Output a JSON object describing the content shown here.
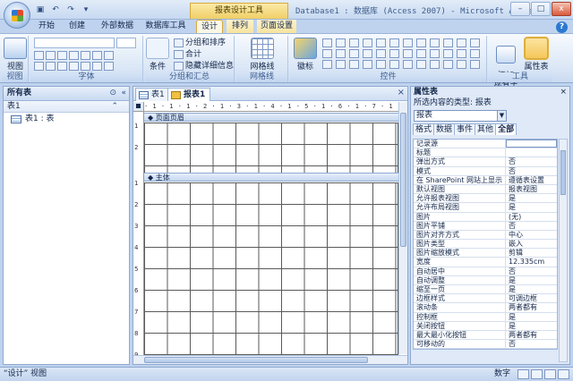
{
  "window": {
    "title": "Database1 : 数据库 (Access 2007) - Microsoft Access",
    "context_tab_title": "报表设计工具",
    "controls": [
      "–",
      "□",
      "x"
    ]
  },
  "ribbon_tabs": [
    "开始",
    "创建",
    "外部数据",
    "数据库工具",
    "设计",
    "排列",
    "页面设置"
  ],
  "active_tab": "设计",
  "ribbon": {
    "views_group": {
      "button": "视图",
      "label": "视图"
    },
    "font_group": {
      "label": "字体"
    },
    "grouping_group": {
      "group_sort": "分组和排序",
      "totals": "合计",
      "hide_details": "隐藏详细信息",
      "condition": "条件",
      "label": "分组和汇总"
    },
    "gridlines_group": {
      "button": "网格线",
      "label": "网格线"
    },
    "controls_group": {
      "logo": "徽标",
      "label": "控件"
    },
    "tools_group": {
      "add_fields": "添加\n现有字段",
      "property_sheet": "属性表",
      "label": "工具"
    }
  },
  "nav_pane": {
    "title": "所有表",
    "group": "表1",
    "items": [
      {
        "label": "表1 : 表"
      }
    ]
  },
  "doc_tabs": [
    {
      "label": "表1",
      "active": false
    },
    {
      "label": "报表1",
      "active": true
    }
  ],
  "designer": {
    "ruler_text": "· 1 · 1 · 1 · 2 · 1 · 3 · 1 · 4 · 1 · 5 · 1 · 6 · 1 · 7 · 1 · 8 · 1 · 9 · 1 ·10· 1 ·11· 1 ·12",
    "v_ticks": [
      "1",
      "2",
      "1",
      "2",
      "3",
      "4",
      "5",
      "6",
      "7",
      "8",
      "9"
    ],
    "sections": {
      "page_header": "页面页眉",
      "detail": "主体"
    }
  },
  "property_sheet": {
    "title": "属性表",
    "selection_type": "所选内容的类型: 报表",
    "selected_object": "报表",
    "tabs": [
      "格式",
      "数据",
      "事件",
      "其他",
      "全部"
    ],
    "active_tab": "全部",
    "rows": [
      {
        "name": "记录源",
        "value": ""
      },
      {
        "name": "标题",
        "value": ""
      },
      {
        "name": "弹出方式",
        "value": "否"
      },
      {
        "name": "模式",
        "value": "否"
      },
      {
        "name": "在 SharePoint 网站上显示",
        "value": "遵循表设置"
      },
      {
        "name": "默认视图",
        "value": "报表视图"
      },
      {
        "name": "允许报表视图",
        "value": "是"
      },
      {
        "name": "允许布局视图",
        "value": "是"
      },
      {
        "name": "图片",
        "value": "(无)"
      },
      {
        "name": "图片平铺",
        "value": "否"
      },
      {
        "name": "图片对齐方式",
        "value": "中心"
      },
      {
        "name": "图片类型",
        "value": "嵌入"
      },
      {
        "name": "图片缩放模式",
        "value": "剪辑"
      },
      {
        "name": "宽度",
        "value": "12.335cm"
      },
      {
        "name": "自动居中",
        "value": "否"
      },
      {
        "name": "自动调整",
        "value": "是"
      },
      {
        "name": "缩至一页",
        "value": "是"
      },
      {
        "name": "边框样式",
        "value": "可调边框"
      },
      {
        "name": "滚动条",
        "value": "两者都有"
      },
      {
        "name": "控制框",
        "value": "是"
      },
      {
        "name": "关闭按钮",
        "value": "是"
      },
      {
        "name": "最大最小化按钮",
        "value": "两者都有"
      },
      {
        "name": "可移动的",
        "value": "否"
      }
    ]
  },
  "status_bar": {
    "left": "“设计” 视图",
    "right": "数字"
  }
}
